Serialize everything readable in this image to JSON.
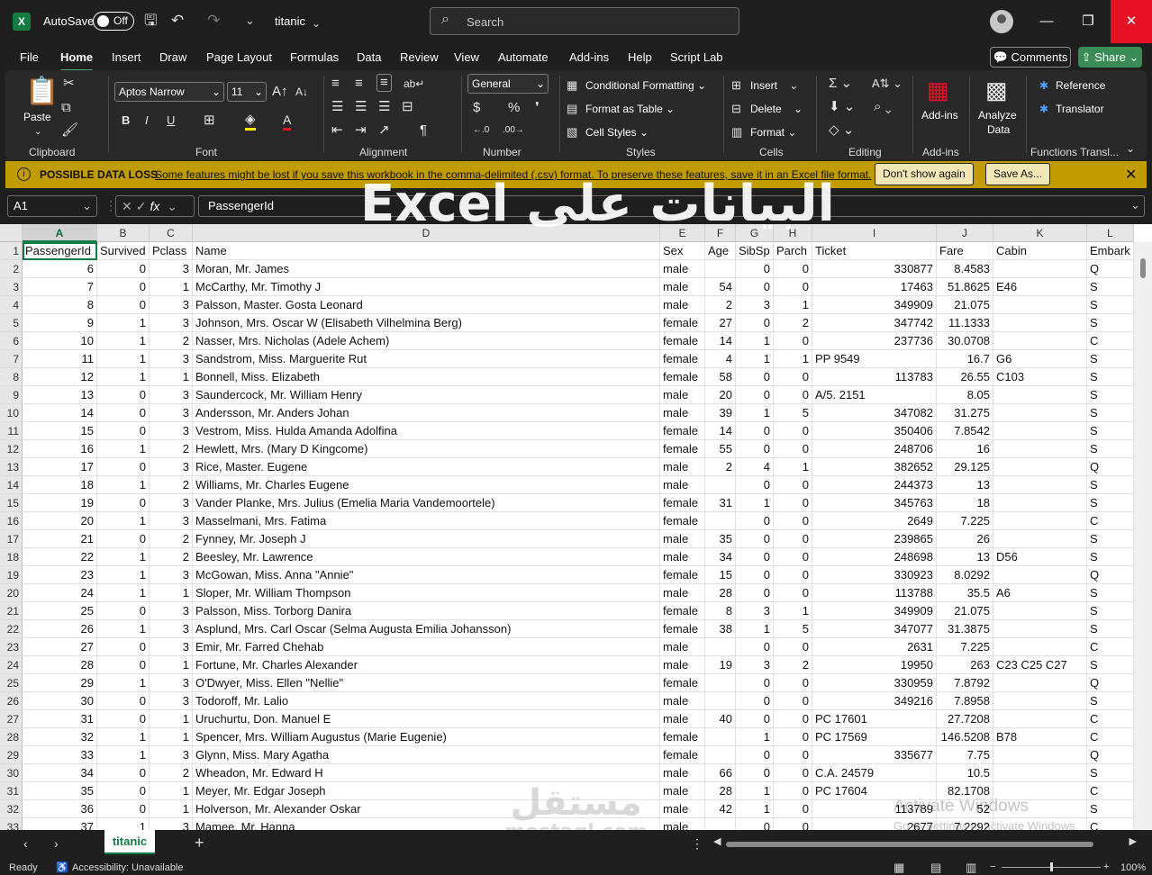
{
  "titlebar": {
    "app_icon": "X",
    "autosave_label": "AutoSave",
    "autosave_state": "Off",
    "filename": "titanic",
    "search_placeholder": "Search"
  },
  "menu": {
    "tabs": [
      "File",
      "Home",
      "Insert",
      "Draw",
      "Page Layout",
      "Formulas",
      "Data",
      "Review",
      "View",
      "Automate",
      "Add-ins",
      "Help",
      "Script Lab"
    ],
    "active": "Home",
    "comments": "Comments",
    "share": "Share"
  },
  "ribbon": {
    "clipboard": {
      "paste": "Paste",
      "label": "Clipboard"
    },
    "font": {
      "name": "Aptos Narrow",
      "size": "11",
      "label": "Font"
    },
    "alignment": {
      "label": "Alignment"
    },
    "number": {
      "format": "General",
      "label": "Number"
    },
    "styles": {
      "conditional": "Conditional Formatting",
      "format_table": "Format as Table",
      "cell_styles": "Cell Styles",
      "label": "Styles"
    },
    "cells": {
      "insert": "Insert",
      "delete": "Delete",
      "format": "Format",
      "label": "Cells"
    },
    "editing": {
      "label": "Editing"
    },
    "addins": {
      "btn": "Add-ins",
      "label": "Add-ins"
    },
    "analyze": {
      "line1": "Analyze",
      "line2": "Data"
    },
    "functions": {
      "reference": "Reference",
      "translator": "Translator",
      "label": "Functions Transl..."
    }
  },
  "banner": {
    "title": "POSSIBLE DATA LOSS",
    "message": "Some features might be lost if you save this workbook in the comma-delimited (.csv) format. To preserve these features, save it in an Excel file format.",
    "dont_show": "Don't show again",
    "save_as": "Save As..."
  },
  "formula_bar": {
    "name_box": "A1",
    "content": "PassengerId"
  },
  "overlay_title": "البيانات على Excel",
  "columns": [
    {
      "letter": "A",
      "w": 83
    },
    {
      "letter": "B",
      "w": 58
    },
    {
      "letter": "C",
      "w": 48
    },
    {
      "letter": "D",
      "w": 519
    },
    {
      "letter": "E",
      "w": 50
    },
    {
      "letter": "F",
      "w": 34
    },
    {
      "letter": "G",
      "w": 42
    },
    {
      "letter": "H",
      "w": 43
    },
    {
      "letter": "I",
      "w": 138
    },
    {
      "letter": "J",
      "w": 63
    },
    {
      "letter": "K",
      "w": 104
    },
    {
      "letter": "L",
      "w": 52
    }
  ],
  "headers": [
    "PassengerId",
    "Survived",
    "Pclass",
    "Name",
    "Sex",
    "Age",
    "SibSp",
    "Parch",
    "Ticket",
    "Fare",
    "Cabin",
    "Embark"
  ],
  "rows": [
    [
      "6",
      "0",
      "3",
      "Moran, Mr. James",
      "male",
      "",
      "0",
      "0",
      "330877",
      "8.4583",
      "",
      "Q"
    ],
    [
      "7",
      "0",
      "1",
      "McCarthy, Mr. Timothy J",
      "male",
      "54",
      "0",
      "0",
      "17463",
      "51.8625",
      "E46",
      "S"
    ],
    [
      "8",
      "0",
      "3",
      "Palsson, Master. Gosta Leonard",
      "male",
      "2",
      "3",
      "1",
      "349909",
      "21.075",
      "",
      "S"
    ],
    [
      "9",
      "1",
      "3",
      "Johnson, Mrs. Oscar W (Elisabeth Vilhelmina Berg)",
      "female",
      "27",
      "0",
      "2",
      "347742",
      "11.1333",
      "",
      "S"
    ],
    [
      "10",
      "1",
      "2",
      "Nasser, Mrs. Nicholas (Adele Achem)",
      "female",
      "14",
      "1",
      "0",
      "237736",
      "30.0708",
      "",
      "C"
    ],
    [
      "11",
      "1",
      "3",
      "Sandstrom, Miss. Marguerite Rut",
      "female",
      "4",
      "1",
      "1",
      "PP 9549",
      "16.7",
      "G6",
      "S"
    ],
    [
      "12",
      "1",
      "1",
      "Bonnell, Miss. Elizabeth",
      "female",
      "58",
      "0",
      "0",
      "113783",
      "26.55",
      "C103",
      "S"
    ],
    [
      "13",
      "0",
      "3",
      "Saundercock, Mr. William Henry",
      "male",
      "20",
      "0",
      "0",
      "A/5. 2151",
      "8.05",
      "",
      "S"
    ],
    [
      "14",
      "0",
      "3",
      "Andersson, Mr. Anders Johan",
      "male",
      "39",
      "1",
      "5",
      "347082",
      "31.275",
      "",
      "S"
    ],
    [
      "15",
      "0",
      "3",
      "Vestrom, Miss. Hulda Amanda Adolfina",
      "female",
      "14",
      "0",
      "0",
      "350406",
      "7.8542",
      "",
      "S"
    ],
    [
      "16",
      "1",
      "2",
      "Hewlett, Mrs. (Mary D Kingcome)",
      "female",
      "55",
      "0",
      "0",
      "248706",
      "16",
      "",
      "S"
    ],
    [
      "17",
      "0",
      "3",
      "Rice, Master. Eugene",
      "male",
      "2",
      "4",
      "1",
      "382652",
      "29.125",
      "",
      "Q"
    ],
    [
      "18",
      "1",
      "2",
      "Williams, Mr. Charles Eugene",
      "male",
      "",
      "0",
      "0",
      "244373",
      "13",
      "",
      "S"
    ],
    [
      "19",
      "0",
      "3",
      "Vander Planke, Mrs. Julius (Emelia Maria Vandemoortele)",
      "female",
      "31",
      "1",
      "0",
      "345763",
      "18",
      "",
      "S"
    ],
    [
      "20",
      "1",
      "3",
      "Masselmani, Mrs. Fatima",
      "female",
      "",
      "0",
      "0",
      "2649",
      "7.225",
      "",
      "C"
    ],
    [
      "21",
      "0",
      "2",
      "Fynney, Mr. Joseph J",
      "male",
      "35",
      "0",
      "0",
      "239865",
      "26",
      "",
      "S"
    ],
    [
      "22",
      "1",
      "2",
      "Beesley, Mr. Lawrence",
      "male",
      "34",
      "0",
      "0",
      "248698",
      "13",
      "D56",
      "S"
    ],
    [
      "23",
      "1",
      "3",
      "McGowan, Miss. Anna \"Annie\"",
      "female",
      "15",
      "0",
      "0",
      "330923",
      "8.0292",
      "",
      "Q"
    ],
    [
      "24",
      "1",
      "1",
      "Sloper, Mr. William Thompson",
      "male",
      "28",
      "0",
      "0",
      "113788",
      "35.5",
      "A6",
      "S"
    ],
    [
      "25",
      "0",
      "3",
      "Palsson, Miss. Torborg Danira",
      "female",
      "8",
      "3",
      "1",
      "349909",
      "21.075",
      "",
      "S"
    ],
    [
      "26",
      "1",
      "3",
      "Asplund, Mrs. Carl Oscar (Selma Augusta Emilia Johansson)",
      "female",
      "38",
      "1",
      "5",
      "347077",
      "31.3875",
      "",
      "S"
    ],
    [
      "27",
      "0",
      "3",
      "Emir, Mr. Farred Chehab",
      "male",
      "",
      "0",
      "0",
      "2631",
      "7.225",
      "",
      "C"
    ],
    [
      "28",
      "0",
      "1",
      "Fortune, Mr. Charles Alexander",
      "male",
      "19",
      "3",
      "2",
      "19950",
      "263",
      "C23 C25 C27",
      "S"
    ],
    [
      "29",
      "1",
      "3",
      "O'Dwyer, Miss. Ellen \"Nellie\"",
      "female",
      "",
      "0",
      "0",
      "330959",
      "7.8792",
      "",
      "Q"
    ],
    [
      "30",
      "0",
      "3",
      "Todoroff, Mr. Lalio",
      "male",
      "",
      "0",
      "0",
      "349216",
      "7.8958",
      "",
      "S"
    ],
    [
      "31",
      "0",
      "1",
      "Uruchurtu, Don. Manuel E",
      "male",
      "40",
      "0",
      "0",
      "PC 17601",
      "27.7208",
      "",
      "C"
    ],
    [
      "32",
      "1",
      "1",
      "Spencer, Mrs. William Augustus (Marie Eugenie)",
      "female",
      "",
      "1",
      "0",
      "PC 17569",
      "146.5208",
      "B78",
      "C"
    ],
    [
      "33",
      "1",
      "3",
      "Glynn, Miss. Mary Agatha",
      "female",
      "",
      "0",
      "0",
      "335677",
      "7.75",
      "",
      "Q"
    ],
    [
      "34",
      "0",
      "2",
      "Wheadon, Mr. Edward H",
      "male",
      "66",
      "0",
      "0",
      "C.A. 24579",
      "10.5",
      "",
      "S"
    ],
    [
      "35",
      "0",
      "1",
      "Meyer, Mr. Edgar Joseph",
      "male",
      "28",
      "1",
      "0",
      "PC 17604",
      "82.1708",
      "",
      "C"
    ],
    [
      "36",
      "0",
      "1",
      "Holverson, Mr. Alexander Oskar",
      "male",
      "42",
      "1",
      "0",
      "113789",
      "52",
      "",
      "S"
    ],
    [
      "37",
      "1",
      "3",
      "Mamee, Mr. Hanna",
      "male",
      "",
      "0",
      "0",
      "2677",
      "7.2292",
      "",
      "C"
    ]
  ],
  "watermark": {
    "line1": "Activate Windows",
    "line2": "Go to Settings to activate Windows."
  },
  "logo_watermark": {
    "ar": "مستقل",
    "en": "mostaql.com"
  },
  "sheet": {
    "tab": "titanic"
  },
  "status": {
    "ready": "Ready",
    "accessibility": "Accessibility: Unavailable",
    "zoom": "100%"
  }
}
